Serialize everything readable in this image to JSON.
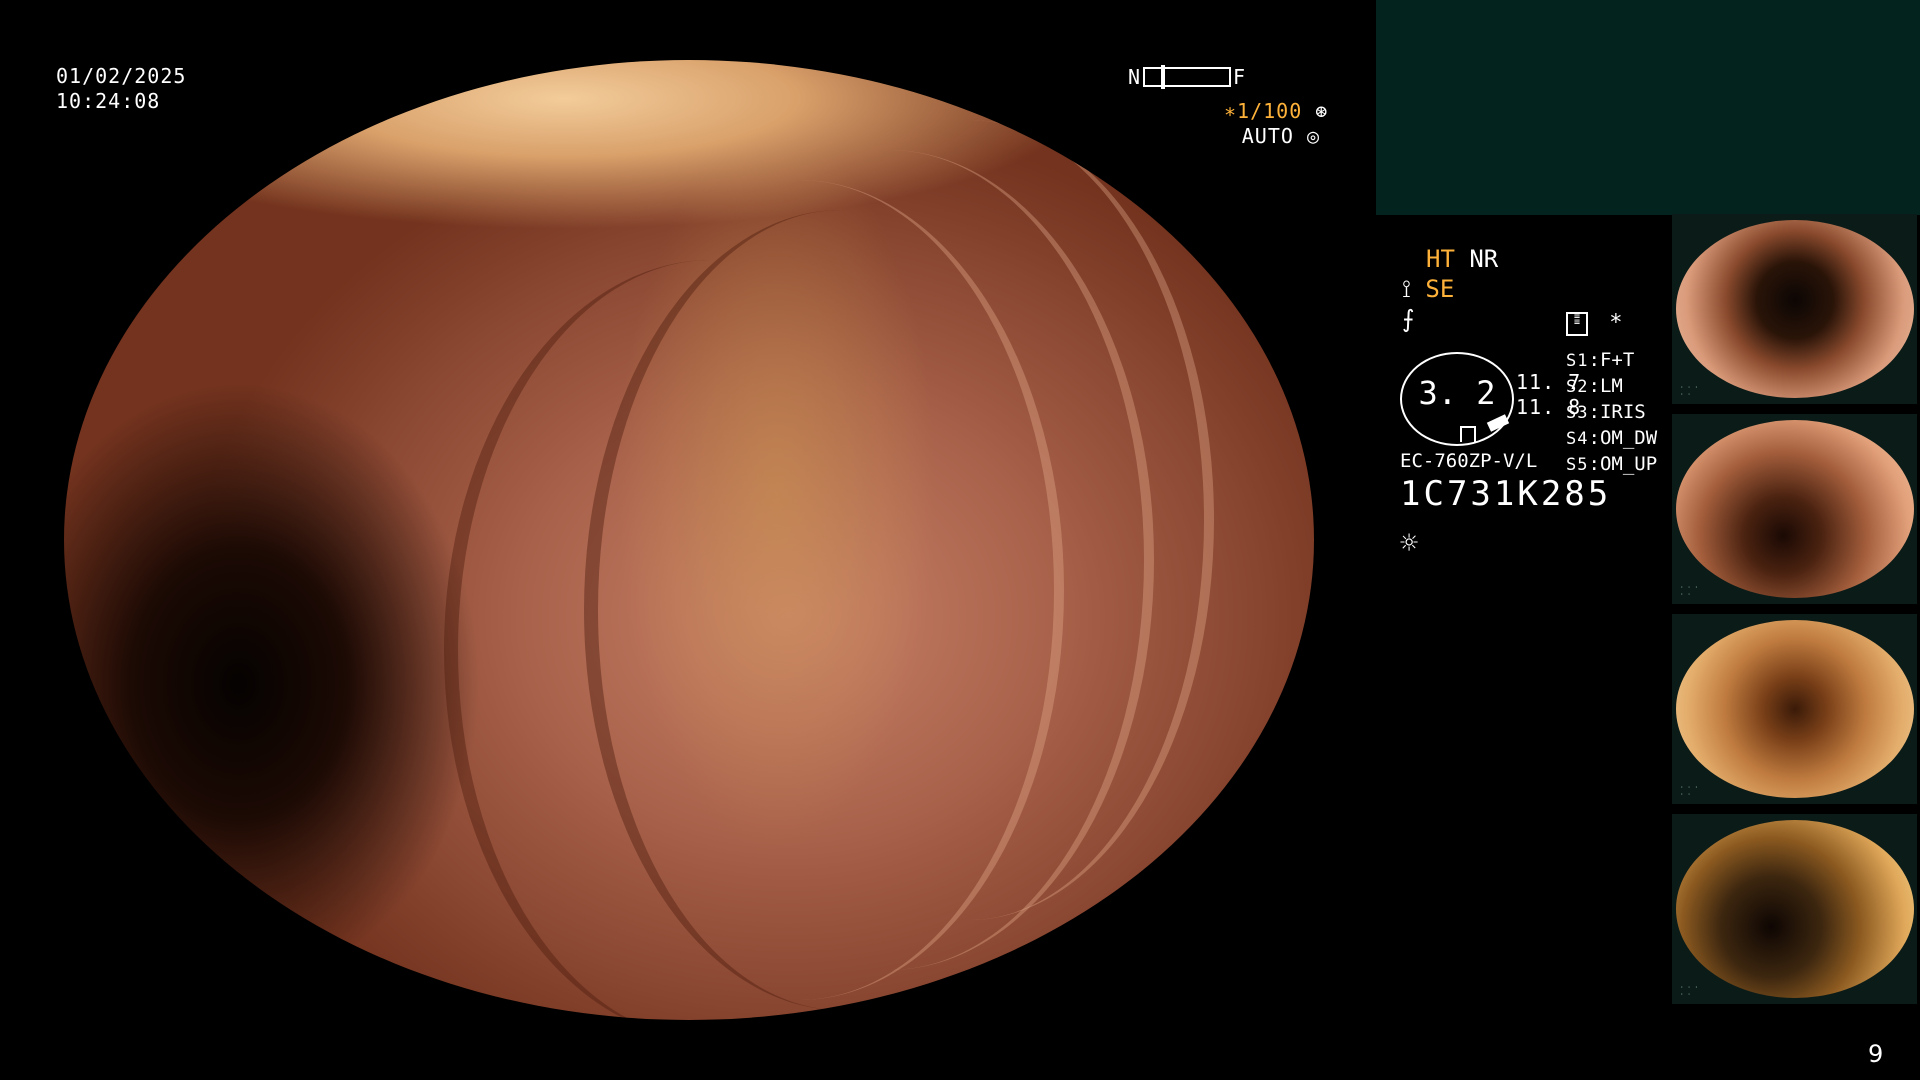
{
  "overlay": {
    "date": "01/02/2025",
    "time": "10:24:08",
    "focus_near": "N",
    "focus_far": "F",
    "shutter": "∗1/100",
    "iris_mode": "AUTO",
    "mode_ht": "HT",
    "mode_nr": "NR",
    "mode_se": "SE",
    "zoom_value": "3. 2",
    "value_upper": "11. 7",
    "value_lower": "11. 8",
    "scope_model": "EC-760ZP-V/L",
    "scope_serial": "1C731K285",
    "asterisk": "∗",
    "page_number": "9"
  },
  "switches": [
    {
      "key": "S1",
      "value": "F+T"
    },
    {
      "key": "S2",
      "value": "LM"
    },
    {
      "key": "S3",
      "value": "IRIS"
    },
    {
      "key": "S4",
      "value": "OM_DW"
    },
    {
      "key": "S5",
      "value": "OM_UP"
    }
  ],
  "colors": {
    "accent_orange": "#ffb23a",
    "panel_teal": "#03231f",
    "background": "#000000"
  },
  "icons": [
    "shutter-icon",
    "iris-icon",
    "structure-enhance-icon",
    "freeze-icon",
    "memo-icon",
    "light-icon"
  ]
}
